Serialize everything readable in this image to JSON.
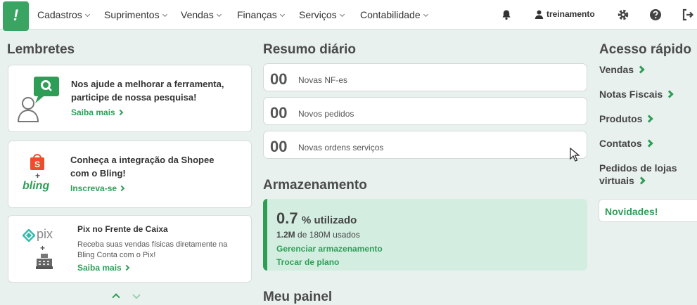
{
  "nav": {
    "items": [
      {
        "label": "Cadastros"
      },
      {
        "label": "Suprimentos"
      },
      {
        "label": "Vendas"
      },
      {
        "label": "Finanças"
      },
      {
        "label": "Serviços"
      },
      {
        "label": "Contabilidade"
      }
    ],
    "user": "treinamento",
    "logo_text": "!"
  },
  "reminders": {
    "heading": "Lembretes",
    "items": [
      {
        "title": "Nos ajude a melhorar a ferramenta, participe de nossa pesquisa!",
        "link": "Saiba mais"
      },
      {
        "title": "Conheça a integração da Shopee com o Bling!",
        "link": "Inscreva-se",
        "logo_text": "bling"
      },
      {
        "title": "Pix no Frente de Caixa",
        "text": "Receba suas vendas físicas diretamente na Bling Conta com o Pix!",
        "link": "Saiba mais",
        "logo_text": "pix"
      }
    ]
  },
  "summary": {
    "heading": "Resumo diário",
    "items": [
      {
        "value": "00",
        "label": "Novas NF-es"
      },
      {
        "value": "00",
        "label": "Novos pedidos"
      },
      {
        "value": "00",
        "label": "Novas ordens serviços"
      }
    ]
  },
  "storage": {
    "heading": "Armazenamento",
    "percent": "0.7",
    "percent_suffix": "% utilizado",
    "used": "1.2M",
    "used_suffix": "de 180M usados",
    "manage_link": "Gerenciar armazenamento",
    "plan_link": "Trocar de plano"
  },
  "panel": {
    "heading": "Meu painel"
  },
  "quick_access": {
    "heading": "Acesso rápido",
    "items": [
      {
        "label": "Vendas"
      },
      {
        "label": "Notas Fiscais"
      },
      {
        "label": "Produtos"
      },
      {
        "label": "Contatos"
      },
      {
        "label": "Pedidos de lojas virtuais"
      }
    ],
    "news": "Novidades!"
  },
  "colors": {
    "brand": "#3aa562",
    "accent": "#2e9e57",
    "background": "#e9f1ee",
    "storage_bg": "#d3eee0"
  }
}
